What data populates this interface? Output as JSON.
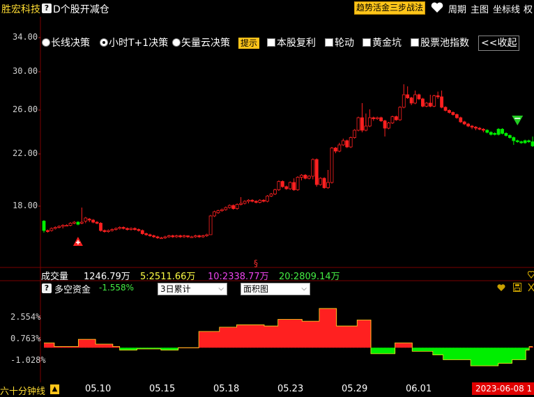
{
  "header": {
    "stock_name": "胜宏科技",
    "help_icon": "?",
    "formula_name": "D个股开减仓",
    "strategy_button": "趋势活金三步战法",
    "links": [
      "周期",
      "主图",
      "坐标线",
      "权"
    ]
  },
  "options": {
    "items": [
      {
        "type": "radio",
        "label": "长线决策",
        "selected": false
      },
      {
        "type": "radio",
        "label": "小时T+1决策",
        "selected": true
      },
      {
        "type": "radio",
        "label": "矢量云决策",
        "selected": false
      },
      {
        "type": "tag",
        "label": "提示"
      },
      {
        "type": "checkbox",
        "label": "本股复利",
        "checked": false
      },
      {
        "type": "checkbox",
        "label": "轮动",
        "checked": false
      },
      {
        "type": "checkbox",
        "label": "黄金坑",
        "checked": false
      },
      {
        "type": "checkbox",
        "label": "股票池指数",
        "checked": false
      },
      {
        "type": "button",
        "label": "<<收起"
      }
    ]
  },
  "price_axis": [
    "34.00",
    "30.00",
    "26.00",
    "22.00",
    "18.00"
  ],
  "volume_bar": {
    "label": "成交量",
    "value": "1246.79万",
    "ma5": "5:2511.66万",
    "ma10": "10:2338.77万",
    "ma20": "20:2809.14万",
    "marker": "§"
  },
  "indicator": {
    "name": "多空资金",
    "value": "-1.558%",
    "select_period": "3日累计",
    "select_type": "面积图",
    "pct_axis": [
      "2.554%",
      "0.763%",
      "-1.028%"
    ]
  },
  "bottom": {
    "period": "六十分钟线",
    "warn_icon": "▲",
    "dates": [
      "05.10",
      "05.15",
      "05.18",
      "05.23",
      "05.29",
      "06.01"
    ],
    "cursor_date": "2023-06-08 1"
  },
  "colors": {
    "up": "#ff2020",
    "down": "#00ee00",
    "accent": "#ffc51a",
    "ma10": "#ee44ee",
    "ma20": "#44ee44",
    "ma5": "#ffff44"
  },
  "chart_data": {
    "type": "candlestick",
    "price_ylim": [
      14,
      36
    ],
    "candles": [
      [
        15.6,
        16.5,
        15.4,
        16.6,
        "d"
      ],
      [
        15.6,
        15.5,
        15.4,
        15.7,
        "u"
      ],
      [
        15.6,
        15.8,
        15.5,
        15.9,
        "u"
      ],
      [
        15.8,
        15.9,
        15.7,
        16.0,
        "u"
      ],
      [
        15.9,
        16.0,
        15.8,
        16.1,
        "u"
      ],
      [
        16.0,
        16.1,
        15.8,
        16.2,
        "u"
      ],
      [
        16.1,
        16.1,
        16.0,
        16.2,
        "u"
      ],
      [
        16.1,
        16.3,
        16.0,
        16.4,
        "u"
      ],
      [
        16.3,
        16.4,
        16.2,
        16.5,
        "u"
      ],
      [
        16.4,
        16.2,
        16.1,
        16.5,
        "d"
      ],
      [
        16.3,
        16.4,
        16.2,
        17.8,
        "u"
      ],
      [
        16.5,
        16.8,
        16.3,
        16.9,
        "u"
      ],
      [
        16.7,
        16.6,
        16.4,
        16.8,
        "u"
      ],
      [
        16.6,
        16.4,
        16.3,
        16.7,
        "u"
      ],
      [
        16.4,
        16.3,
        16.2,
        16.5,
        "u"
      ],
      [
        16.3,
        15.6,
        15.5,
        16.4,
        "u"
      ],
      [
        15.6,
        15.5,
        15.4,
        15.7,
        "u"
      ],
      [
        15.5,
        15.6,
        15.4,
        15.7,
        "u"
      ],
      [
        15.6,
        15.7,
        15.5,
        15.8,
        "u"
      ],
      [
        15.7,
        15.8,
        15.6,
        15.9,
        "u"
      ],
      [
        15.8,
        15.9,
        15.7,
        16.0,
        "u"
      ],
      [
        15.9,
        15.8,
        15.7,
        16.0,
        "u"
      ],
      [
        15.8,
        15.7,
        15.6,
        15.9,
        "u"
      ],
      [
        15.7,
        15.8,
        15.6,
        15.9,
        "u"
      ],
      [
        15.8,
        15.7,
        15.6,
        15.9,
        "u"
      ],
      [
        15.7,
        15.6,
        15.5,
        15.8,
        "u"
      ],
      [
        15.6,
        15.3,
        15.2,
        15.7,
        "u"
      ],
      [
        15.3,
        15.2,
        15.1,
        15.4,
        "u"
      ],
      [
        15.2,
        15.1,
        15.0,
        15.3,
        "u"
      ],
      [
        15.1,
        15.0,
        14.9,
        15.2,
        "u"
      ],
      [
        15.0,
        14.9,
        14.8,
        15.1,
        "u"
      ],
      [
        14.9,
        14.9,
        14.8,
        15.0,
        "u"
      ],
      [
        14.9,
        15.0,
        14.8,
        15.1,
        "u"
      ],
      [
        15.0,
        15.1,
        14.9,
        15.2,
        "u"
      ],
      [
        15.1,
        15.0,
        14.9,
        15.2,
        "u"
      ],
      [
        15.0,
        15.1,
        14.9,
        15.2,
        "u"
      ],
      [
        15.1,
        15.0,
        14.9,
        15.2,
        "u"
      ],
      [
        15.0,
        15.1,
        14.9,
        15.2,
        "u"
      ],
      [
        15.1,
        15.0,
        14.9,
        15.1,
        "u"
      ],
      [
        15.0,
        15.0,
        14.9,
        15.1,
        "u"
      ],
      [
        15.0,
        15.1,
        14.9,
        15.2,
        "u"
      ],
      [
        15.1,
        15.0,
        14.9,
        15.2,
        "u"
      ],
      [
        15.0,
        15.1,
        14.9,
        15.2,
        "u"
      ],
      [
        15.1,
        15.2,
        15.0,
        15.3,
        "u"
      ],
      [
        15.2,
        17.0,
        15.2,
        17.1,
        "u"
      ],
      [
        17.0,
        17.4,
        16.9,
        17.5,
        "u"
      ],
      [
        17.3,
        17.5,
        17.2,
        17.6,
        "u"
      ],
      [
        17.5,
        17.6,
        17.4,
        17.7,
        "u"
      ],
      [
        17.6,
        17.8,
        17.5,
        17.9,
        "u"
      ],
      [
        17.8,
        18.0,
        17.7,
        18.1,
        "u"
      ],
      [
        18.0,
        17.7,
        17.6,
        18.1,
        "u"
      ],
      [
        17.7,
        18.1,
        17.6,
        18.2,
        "u"
      ],
      [
        18.1,
        18.2,
        18.0,
        18.8,
        "u"
      ],
      [
        18.2,
        18.4,
        18.1,
        18.5,
        "u"
      ],
      [
        18.4,
        18.5,
        18.2,
        18.6,
        "u"
      ],
      [
        18.5,
        18.4,
        18.3,
        18.6,
        "u"
      ],
      [
        18.4,
        18.3,
        18.2,
        18.5,
        "u"
      ],
      [
        18.3,
        18.5,
        18.2,
        18.6,
        "u"
      ],
      [
        18.5,
        18.4,
        18.3,
        18.6,
        "u"
      ],
      [
        18.4,
        18.9,
        18.3,
        19.0,
        "u"
      ],
      [
        18.9,
        19.1,
        18.8,
        19.2,
        "u"
      ],
      [
        19.1,
        19.5,
        19.0,
        19.6,
        "u"
      ],
      [
        19.5,
        20.3,
        19.4,
        20.4,
        "u"
      ],
      [
        20.3,
        19.8,
        19.7,
        20.4,
        "u"
      ],
      [
        19.8,
        19.6,
        19.5,
        19.9,
        "u"
      ],
      [
        19.6,
        20.2,
        19.5,
        20.3,
        "u"
      ],
      [
        20.2,
        19.5,
        19.4,
        20.6,
        "u"
      ],
      [
        19.5,
        20.7,
        19.4,
        20.8,
        "u"
      ],
      [
        20.7,
        20.9,
        20.4,
        21.0,
        "u"
      ],
      [
        20.9,
        20.6,
        20.5,
        21.0,
        "u"
      ],
      [
        20.6,
        20.8,
        20.5,
        20.9,
        "u"
      ],
      [
        20.8,
        22.4,
        20.5,
        22.5,
        "u"
      ],
      [
        22.4,
        20.0,
        19.8,
        22.5,
        "u"
      ],
      [
        20.0,
        20.6,
        19.9,
        20.7,
        "u"
      ],
      [
        20.6,
        19.7,
        19.6,
        20.7,
        "u"
      ],
      [
        19.7,
        20.2,
        19.6,
        21.4,
        "u"
      ],
      [
        20.2,
        23.5,
        20.1,
        23.6,
        "u"
      ],
      [
        23.5,
        23.2,
        23.0,
        23.6,
        "u"
      ],
      [
        23.2,
        23.8,
        23.1,
        24.0,
        "u"
      ],
      [
        23.8,
        24.2,
        23.7,
        24.4,
        "u"
      ],
      [
        24.2,
        23.6,
        23.5,
        24.3,
        "u"
      ],
      [
        23.6,
        24.5,
        23.5,
        24.6,
        "u"
      ],
      [
        24.5,
        25.2,
        24.4,
        25.3,
        "u"
      ],
      [
        25.2,
        26.4,
        25.1,
        26.5,
        "u"
      ],
      [
        26.4,
        25.2,
        25.0,
        27.8,
        "u"
      ],
      [
        25.2,
        25.6,
        25.1,
        26.8,
        "u"
      ],
      [
        25.6,
        26.4,
        25.5,
        27.2,
        "u"
      ],
      [
        26.4,
        26.3,
        26.1,
        26.5,
        "u"
      ],
      [
        26.3,
        26.4,
        26.2,
        26.5,
        "u"
      ],
      [
        26.4,
        26.1,
        26.0,
        26.5,
        "u"
      ],
      [
        26.1,
        25.4,
        24.6,
        26.2,
        "u"
      ],
      [
        25.4,
        25.9,
        25.3,
        26.0,
        "u"
      ],
      [
        25.9,
        26.5,
        25.8,
        26.6,
        "u"
      ],
      [
        26.5,
        26.2,
        26.1,
        26.6,
        "u"
      ],
      [
        26.2,
        27.4,
        26.1,
        27.5,
        "u"
      ],
      [
        27.4,
        28.6,
        27.3,
        29.6,
        "u"
      ],
      [
        28.6,
        28.3,
        28.2,
        29.4,
        "u"
      ],
      [
        28.3,
        27.8,
        27.6,
        28.4,
        "u"
      ],
      [
        27.8,
        28.6,
        27.7,
        29.0,
        "u"
      ],
      [
        28.6,
        28.2,
        28.1,
        28.7,
        "u"
      ],
      [
        28.2,
        27.5,
        27.4,
        28.3,
        "u"
      ],
      [
        27.5,
        27.8,
        27.4,
        27.9,
        "u"
      ],
      [
        27.8,
        27.5,
        27.4,
        28.6,
        "u"
      ],
      [
        27.5,
        28.5,
        27.4,
        28.6,
        "u"
      ],
      [
        28.5,
        28.4,
        28.2,
        28.9,
        "u"
      ],
      [
        28.4,
        27.4,
        27.3,
        29.0,
        "u"
      ],
      [
        27.4,
        27.1,
        27.0,
        27.5,
        "u"
      ],
      [
        27.1,
        26.9,
        26.8,
        27.2,
        "u"
      ],
      [
        26.9,
        26.7,
        26.6,
        27.0,
        "u"
      ],
      [
        26.7,
        26.4,
        26.3,
        26.8,
        "u"
      ],
      [
        26.4,
        26.0,
        25.9,
        26.5,
        "u"
      ],
      [
        26.0,
        25.8,
        25.7,
        26.1,
        "u"
      ],
      [
        25.8,
        25.6,
        25.5,
        25.9,
        "u"
      ],
      [
        25.6,
        25.5,
        25.3,
        25.7,
        "u"
      ],
      [
        25.5,
        25.4,
        25.2,
        25.6,
        "u"
      ],
      [
        25.4,
        25.3,
        25.2,
        25.5,
        "u"
      ],
      [
        25.3,
        25.2,
        25.0,
        25.4,
        "u"
      ],
      [
        25.2,
        25.0,
        24.9,
        25.3,
        "d"
      ],
      [
        25.0,
        24.8,
        24.7,
        25.1,
        "d"
      ],
      [
        24.9,
        24.8,
        24.7,
        25.0,
        "d"
      ],
      [
        24.8,
        25.3,
        24.7,
        25.4,
        "d"
      ],
      [
        25.3,
        24.9,
        24.8,
        25.4,
        "d"
      ],
      [
        24.9,
        24.7,
        24.6,
        25.0,
        "d"
      ],
      [
        24.7,
        24.5,
        24.4,
        24.8,
        "d"
      ],
      [
        24.5,
        24.2,
        23.8,
        24.6,
        "d"
      ],
      [
        24.2,
        24.1,
        24.0,
        24.3,
        "d"
      ],
      [
        24.1,
        24.0,
        23.9,
        24.2,
        "d"
      ],
      [
        24.0,
        24.2,
        23.9,
        24.3,
        "d"
      ],
      [
        24.2,
        24.1,
        24.0,
        24.3,
        "d"
      ],
      [
        24.1,
        23.7,
        23.6,
        24.6,
        "d"
      ]
    ],
    "fund_flow_pct": [
      0.4,
      0.4,
      0.4,
      0.1,
      0.1,
      0.1,
      0.1,
      0.1,
      0.1,
      0.1,
      0.7,
      0.7,
      0.7,
      0.7,
      0.7,
      0.3,
      0.3,
      0.3,
      0.3,
      0.3,
      0.1,
      0.1,
      -0.2,
      -0.2,
      -0.2,
      -0.2,
      -0.2,
      -0.1,
      -0.1,
      -0.1,
      -0.1,
      -0.1,
      -0.1,
      -0.1,
      -0.2,
      -0.2,
      -0.2,
      -0.2,
      -0.2,
      0.0,
      0.0,
      0.0,
      0.0,
      0.0,
      0.0,
      1.35,
      1.35,
      1.35,
      1.35,
      1.35,
      1.35,
      1.7,
      1.7,
      1.7,
      1.7,
      1.7,
      1.9,
      1.9,
      1.9,
      1.9,
      1.9,
      1.9,
      1.9,
      1.9,
      1.8,
      1.8,
      1.8,
      1.8,
      2.35,
      2.35,
      2.35,
      2.35,
      2.35,
      2.35,
      2.35,
      2.2,
      2.2,
      2.2,
      2.2,
      2.2,
      3.25,
      3.25,
      3.25,
      3.25,
      3.25,
      1.8,
      1.8,
      1.8,
      1.8,
      1.8,
      1.8,
      2.3,
      2.3,
      2.3,
      2.3,
      -0.5,
      -0.5,
      -0.5,
      -0.5,
      -0.5,
      -0.5,
      -0.5,
      0.4,
      0.4,
      0.4,
      0.4,
      0.4,
      -0.3,
      -0.3,
      -0.3,
      -0.3,
      -0.3,
      -0.3,
      -0.6,
      -0.6,
      -0.6,
      -1.0,
      -1.0,
      -1.0,
      -1.0,
      -1.0,
      -1.0,
      -1.0,
      -1.0,
      -1.5,
      -1.5,
      -1.5,
      -1.5,
      -1.5,
      -1.5,
      -1.5,
      -1.5,
      -1.3,
      -1.3,
      -1.3,
      -1.3,
      -1.0,
      -1.0,
      -1.0,
      -1.0,
      -0.2,
      0.1
    ],
    "pct_ylim": [
      -1.6,
      3.5
    ],
    "markers": {
      "buy_index": 9,
      "sell_index": 125
    }
  }
}
